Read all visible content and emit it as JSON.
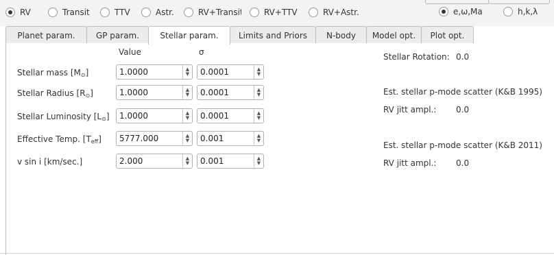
{
  "modes": [
    {
      "label": "RV",
      "checked": true
    },
    {
      "label": "Transit",
      "checked": false
    },
    {
      "label": "TTV",
      "checked": false
    },
    {
      "label": "Astr.",
      "checked": false
    },
    {
      "label": "RV+Transit",
      "checked": false
    },
    {
      "label": "RV+TTV",
      "checked": false
    },
    {
      "label": "RV+Astr.",
      "checked": false
    }
  ],
  "param_modes": [
    {
      "label": "e,ω,Ma",
      "checked": true
    },
    {
      "label": "h,k,λ",
      "checked": false
    }
  ],
  "tabs": [
    {
      "label": "Planet param.",
      "active": false
    },
    {
      "label": "GP param.",
      "active": false
    },
    {
      "label": "Stellar param.",
      "active": true
    },
    {
      "label": "Limits and Priors",
      "active": false
    },
    {
      "label": "N-body",
      "active": false
    },
    {
      "label": "Model opt.",
      "active": false
    },
    {
      "label": "Plot opt.",
      "active": false
    }
  ],
  "headers": {
    "value": "Value",
    "sigma": "σ"
  },
  "params": [
    {
      "label_main": "Stellar mass [M",
      "label_sub": "⊙",
      "label_end": "]",
      "value": "1.0000",
      "sigma": "0.0001"
    },
    {
      "label_main": "Stellar Radius [R",
      "label_sub": "⊙",
      "label_end": "]",
      "value": "1.0000",
      "sigma": "0.0001"
    },
    {
      "label_main": "Stellar Luminosity [L",
      "label_sub": "⊙",
      "label_end": "]",
      "value": "1.0000",
      "sigma": "0.0001"
    },
    {
      "label_main": "Effective Temp. [T",
      "label_sub": "eff",
      "label_end": "]",
      "value": "5777.000",
      "sigma": "0.001"
    },
    {
      "label_main": "v sin i [km/sec.]",
      "label_sub": "",
      "label_end": "",
      "value": "2.000",
      "sigma": "0.001"
    }
  ],
  "right": {
    "rotation_label": "Stellar Rotation:",
    "rotation_value": "0.0",
    "kb1995_label": "Est. stellar p-mode scatter (K&B 1995)",
    "jitt1_label": "RV jitt ampl.:",
    "jitt1_value": "0.0",
    "kb2011_label": "Est. stellar p-mode scatter (K&B 2011)",
    "jitt2_label": "RV jitt ampl.:",
    "jitt2_value": "0.0"
  }
}
